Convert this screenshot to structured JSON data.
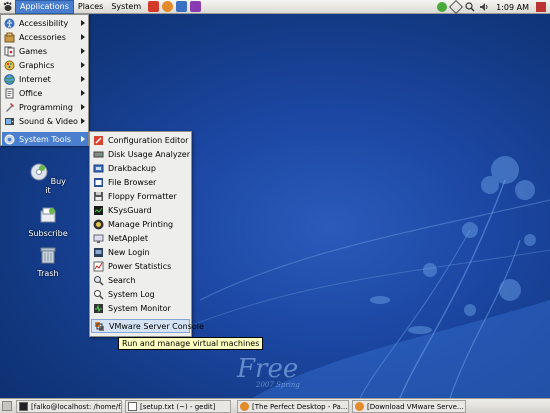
{
  "top_panel": {
    "menus": [
      "Applications",
      "Places",
      "System"
    ],
    "clock": "1:09 AM"
  },
  "app_menu": {
    "items": [
      {
        "label": "Accessibility",
        "icon": "accessibility-icon"
      },
      {
        "label": "Accessories",
        "icon": "accessories-icon"
      },
      {
        "label": "Games",
        "icon": "games-icon"
      },
      {
        "label": "Graphics",
        "icon": "graphics-icon"
      },
      {
        "label": "Internet",
        "icon": "internet-icon"
      },
      {
        "label": "Office",
        "icon": "office-icon"
      },
      {
        "label": "Programming",
        "icon": "programming-icon"
      },
      {
        "label": "Sound & Video",
        "icon": "sound-video-icon"
      },
      {
        "label": "System Tools",
        "icon": "system-tools-icon"
      }
    ],
    "highlighted": "System Tools"
  },
  "system_tools_menu": {
    "items": [
      "Configuration Editor",
      "Disk Usage Analyzer",
      "Drakbackup",
      "File Browser",
      "Floppy Formatter",
      "KSysGuard",
      "Manage Printing",
      "NetApplet",
      "New Login",
      "Power Statistics",
      "Search",
      "System Log",
      "System Monitor",
      "VMware Server Console"
    ],
    "highlighted": "VMware Server Console"
  },
  "tooltip": "Run and manage virtual machines",
  "desktop_icons": [
    {
      "label": "Buy it",
      "icon": "cd-icon"
    },
    {
      "label": "Subscribe",
      "icon": "subscribe-icon"
    },
    {
      "label": "Trash",
      "icon": "trash-icon"
    }
  ],
  "wallpaper": {
    "brand": "Free",
    "edition": "2007 Spring"
  },
  "taskbar": [
    "[falko@localhost: /home/f...",
    "[setup.txt (~) - gedit]",
    "[The Perfect Desktop - Pa...",
    "[Download VMware Serve..."
  ],
  "colors": {
    "highlight": "#4a7fd0",
    "menu_bg": "#eeeeec",
    "desktop": "#1c47a3",
    "tooltip": "#ffffbf"
  }
}
